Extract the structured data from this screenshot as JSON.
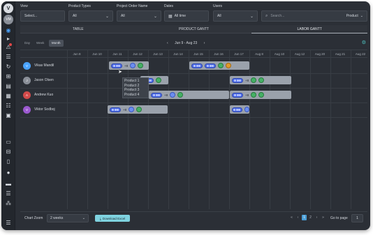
{
  "app": {
    "logo_text": "V",
    "avatar_text": "VM"
  },
  "filters": {
    "view": {
      "label": "View",
      "value": "Select..."
    },
    "product_types": {
      "label": "Product Types",
      "value": "All"
    },
    "project_order_name": {
      "label": "Project Order Name",
      "value": "All"
    },
    "dates": {
      "label": "Dates",
      "value": "All time"
    },
    "users": {
      "label": "Users",
      "value": "All"
    },
    "search": {
      "placeholder": "Search...",
      "scope": "Product"
    }
  },
  "tabs": [
    {
      "label": "TABLE"
    },
    {
      "label": "PRODUCT GANTT"
    },
    {
      "label": "LABOR GANTT"
    }
  ],
  "toolbar": {
    "modes": [
      "Day",
      "Week",
      "Month"
    ],
    "active_mode": "Month",
    "date_range": "Jun 9 - Aug 23"
  },
  "columns": [
    "Jun 8",
    "Jun 10",
    "Jun 11",
    "Jun 12",
    "Jun 13",
    "Jun 14",
    "Jun 15",
    "Jun 16",
    "Jun 17",
    "Aug 8",
    "Aug 10",
    "Aug 12",
    "Aug 20",
    "Aug 21",
    "Aug 22",
    "Aug 23"
  ],
  "people": [
    {
      "name": "Vikas Mandil",
      "initials": "V",
      "color": "#4aa3ff"
    },
    {
      "name": "Jason Olsen",
      "initials": "J",
      "color": "#8a8f98"
    },
    {
      "name": "Andrew Kuo",
      "initials": "A",
      "color": "#d24a4a"
    },
    {
      "name": "Viktor Sodboj",
      "initials": "V",
      "color": "#9b59d0"
    }
  ],
  "chip_extra": "+8",
  "tooltip": [
    "Product 1",
    "Product 2",
    "Product 3",
    "Product 4"
  ],
  "footer": {
    "zoom_label": "Chart Zoom",
    "zoom_value": "2 weeks",
    "download_label": "Download Excel",
    "pages": [
      "«",
      "‹",
      "1",
      "2",
      "›",
      "»"
    ],
    "active_page": "1",
    "goto_label": "Go to page",
    "goto_value": "1"
  },
  "colors": {
    "accent": "#4aa3ff",
    "download": "#7fd3e0",
    "gear": "#4ec3c1"
  }
}
